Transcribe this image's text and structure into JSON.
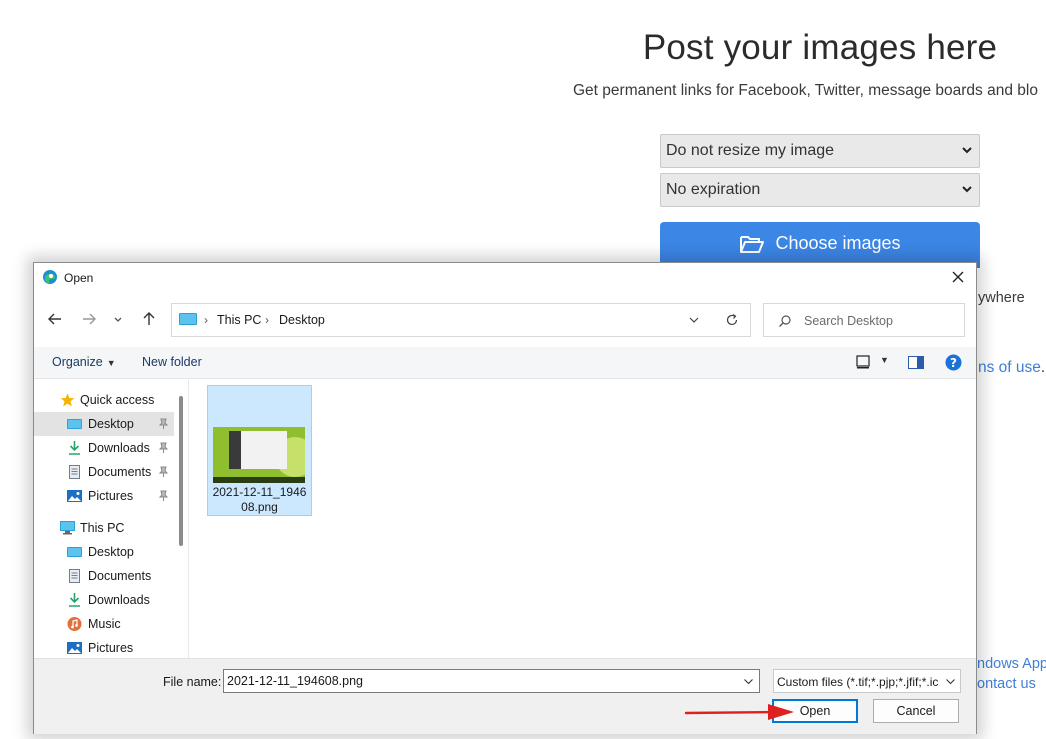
{
  "page": {
    "title": "Post your images here",
    "subtitle": "Get permanent links for Facebook, Twitter, message boards and blo",
    "resize_select": "Do not resize my image",
    "expiration_select": "No expiration",
    "choose_button": "Choose images",
    "frag_anywhere": "ywhere",
    "frag_terms": "ns of use",
    "frag_period": ".",
    "frag_windows_app": "ndows App",
    "frag_contact": "ontact us"
  },
  "dialog": {
    "title": "Open",
    "breadcrumb": [
      "This PC",
      "Desktop"
    ],
    "search_placeholder": "Search Desktop",
    "toolbar": {
      "organize": "Organize",
      "new_folder": "New folder"
    },
    "nav": {
      "quick_access": "Quick access",
      "quick_items": [
        "Desktop",
        "Downloads",
        "Documents",
        "Pictures"
      ],
      "this_pc": "This PC",
      "pc_items": [
        "Desktop",
        "Documents",
        "Downloads",
        "Music",
        "Pictures"
      ]
    },
    "file": {
      "name": "2021-12-11_194608.png"
    },
    "filename_label": "File name:",
    "filename_value": "2021-12-11_194608.png",
    "filter_value": "Custom files (*.tif;*.pjp;*.jfif;*.ic",
    "open_button": "Open",
    "cancel_button": "Cancel"
  },
  "colors": {
    "accent": "#3c86e6",
    "selection": "#cce8ff",
    "arrow": "#e02020",
    "link": "#3f7fd6"
  }
}
